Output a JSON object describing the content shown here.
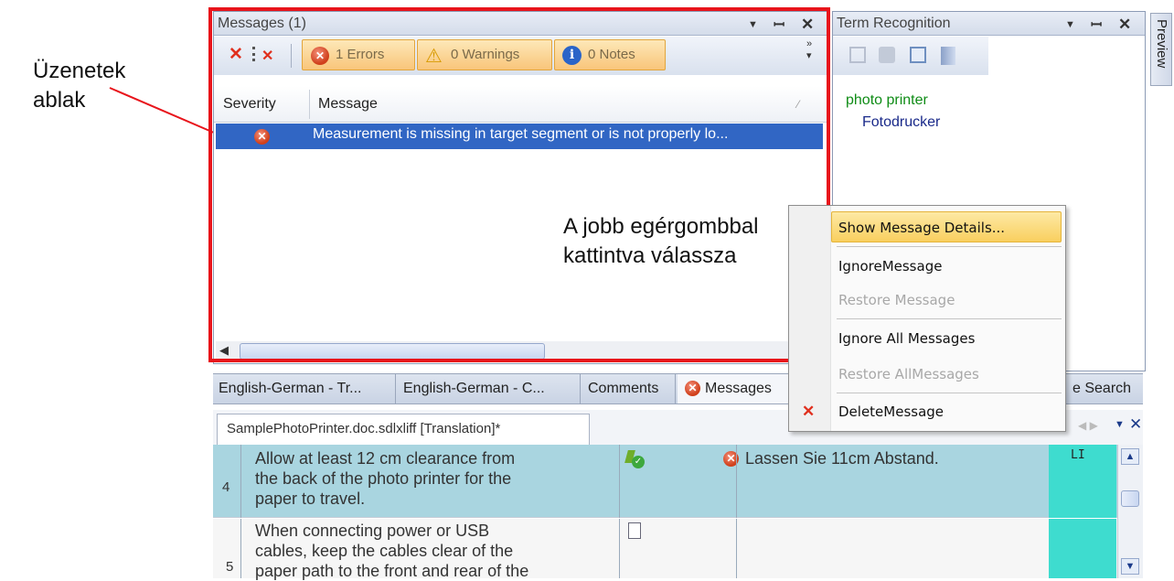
{
  "annotations": {
    "left_label": [
      "Üzenetek",
      "ablak"
    ],
    "right_label": [
      "A jobb egérgombbal",
      "kattintva válassza"
    ]
  },
  "messages_panel": {
    "title": "Messages (1)",
    "filters": {
      "errors": "1 Errors",
      "warnings": "0 Warnings",
      "notes": "0 Notes"
    },
    "columns": {
      "severity": "Severity",
      "message": "Message"
    },
    "rows": [
      {
        "severity": "error",
        "message": "Measurement is missing in target segment or is not properly lo..."
      }
    ]
  },
  "term_panel": {
    "title": "Term Recognition",
    "source_term": "photo printer",
    "target_term": "Fotodrucker"
  },
  "preview_tab": "Preview",
  "context_menu": {
    "items": [
      {
        "label": "Show Message Details...",
        "enabled": true,
        "highlighted": true
      },
      {
        "label": "IgnoreMessage",
        "enabled": true
      },
      {
        "label": "Restore Message",
        "enabled": false
      },
      {
        "label": "Ignore All Messages",
        "enabled": true
      },
      {
        "label": "Restore AllMessages",
        "enabled": false
      },
      {
        "label": "DeleteMessage",
        "enabled": true
      }
    ]
  },
  "bottom_tabs": [
    "English-German - Tr...",
    "English-German - C...",
    "Comments",
    "Messages",
    "e Search"
  ],
  "document_tab": "SamplePhotoPrinter.doc.sdlxliff [Translation]*",
  "segments": [
    {
      "number": "4",
      "source_lines": [
        "Allow at least 12 cm clearance from",
        "the back of the photo printer for the",
        "paper to travel."
      ],
      "target": "Lassen Sie 11cm Abstand.",
      "status": "LI"
    },
    {
      "number": "5",
      "source_lines": [
        "When connecting power or USB",
        "cables, keep the cables clear of the",
        "paper path to the front and rear of the"
      ],
      "target": "",
      "status": ""
    }
  ],
  "colors": {
    "highlight_frame": "#e8141b",
    "selection": "#3166c4",
    "segment_active": "#a9d5e0",
    "status_col": "#3edccf",
    "menu_highlight": "#f9cf5f"
  }
}
